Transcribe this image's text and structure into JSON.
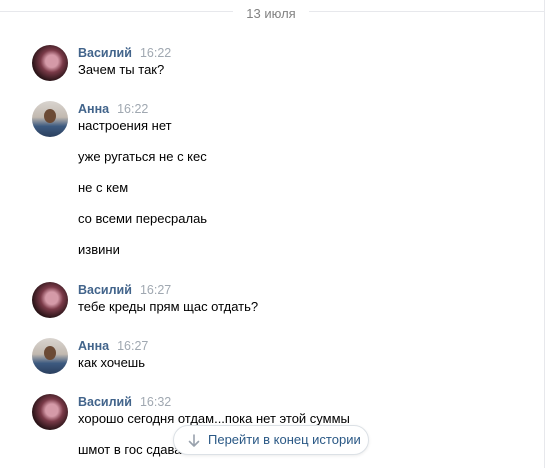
{
  "date_separator": "13 июля",
  "messages": [
    {
      "author": "Василий",
      "time": "16:22",
      "lines": [
        "Зачем ты так?"
      ]
    },
    {
      "author": "Анна",
      "time": "16:22",
      "lines": [
        "настроения нет",
        "уже ругаться не с кес",
        "не с кем",
        "со всеми пересралаь",
        "извини"
      ]
    },
    {
      "author": "Василий",
      "time": "16:27",
      "lines": [
        "тебе креды прям щас отдать?"
      ]
    },
    {
      "author": "Анна",
      "time": "16:27",
      "lines": [
        "как хочешь"
      ]
    },
    {
      "author": "Василий",
      "time": "16:32",
      "lines": [
        "хорошо сегодня отдам...пока нет этой суммы",
        "шмот в гос сдавать"
      ]
    }
  ],
  "jump_button": {
    "label": "Перейти в конец истории",
    "icon": "arrow-down-icon"
  },
  "colors": {
    "author": "#42648b",
    "time": "#a0a8b1",
    "link": "#2a5885",
    "divider": "#e7e8ec"
  }
}
